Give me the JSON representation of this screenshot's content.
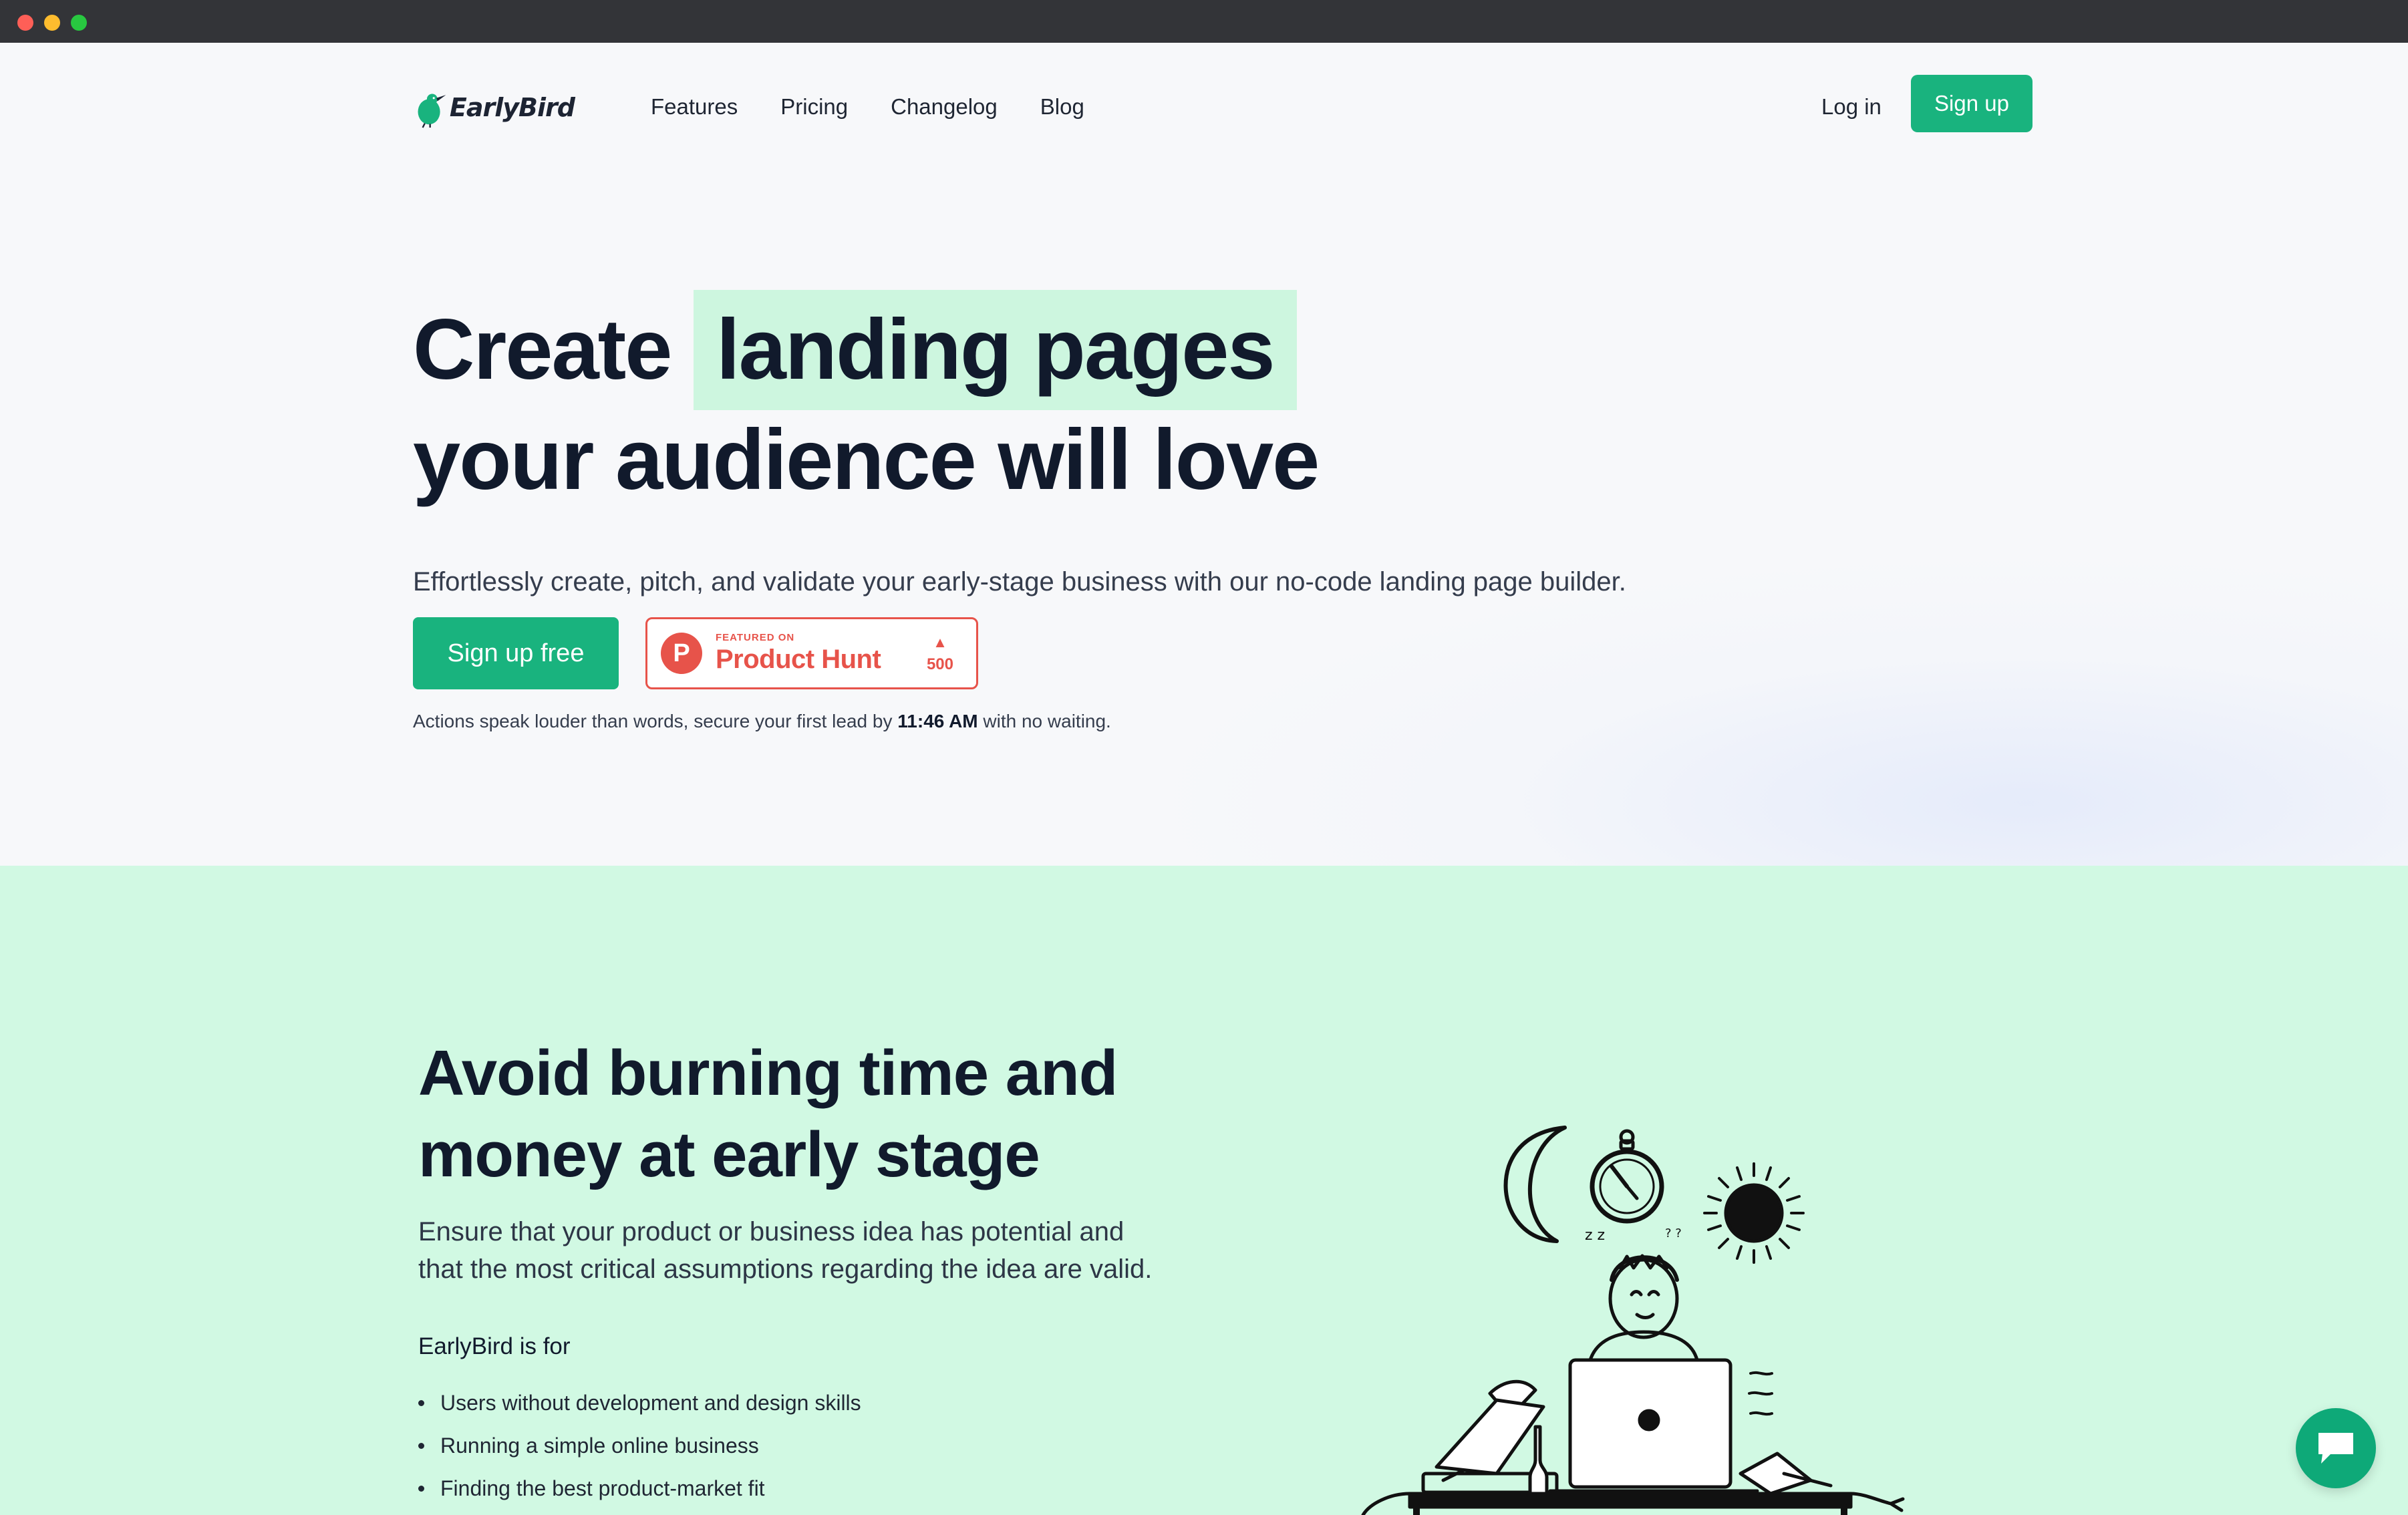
{
  "brand": {
    "name": "EarlyBird",
    "accent": "#19b37e",
    "highlight": "#cdf6df",
    "section_bg": "#d1f9e3"
  },
  "nav": {
    "items": [
      {
        "label": "Features"
      },
      {
        "label": "Pricing"
      },
      {
        "label": "Changelog"
      },
      {
        "label": "Blog"
      }
    ],
    "login": "Log in",
    "signup": "Sign up"
  },
  "hero": {
    "title_pre": "Create",
    "title_highlight": "landing pages",
    "title_line2": "your audience will love",
    "subtitle": "Effortlessly create, pitch, and validate your early-stage business with our no-code landing page builder.",
    "cta_label": "Sign up free",
    "product_hunt": {
      "featured": "FEATURED ON",
      "name": "Product Hunt",
      "votes": "500",
      "logo_letter": "P"
    },
    "note_pre": "Actions speak louder than words, secure your first lead by",
    "note_time": "11:46 AM",
    "note_post": "with no waiting."
  },
  "section": {
    "title_line1": "Avoid burning time and",
    "title_line2": "money at early stage",
    "description": "Ensure that your product or business idea has potential and that the most critical assumptions regarding the idea are valid.",
    "for_heading": "EarlyBird is for",
    "audience": [
      "Users without development and design skills",
      "Running a simple online business",
      "Finding the best product-market fit"
    ]
  },
  "icons": {
    "logo": "bird-logo-icon",
    "product_hunt": "product-hunt-icon",
    "upvote": "upvote-arrow-icon",
    "chat": "chat-bubble-icon",
    "illustration": "person-at-desk-illustration"
  }
}
